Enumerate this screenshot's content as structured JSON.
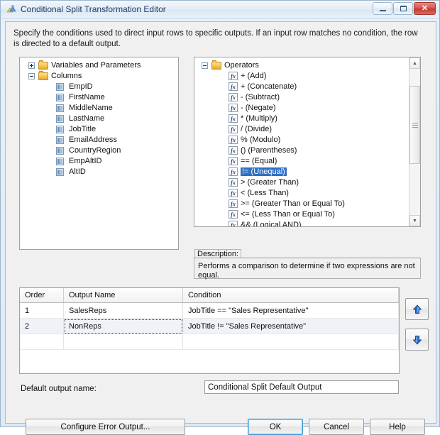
{
  "window": {
    "title": "Conditional Split Transformation Editor",
    "icon": "conditional-split-icon",
    "controls": {
      "minimize": "Minimize",
      "maximize": "Maximize",
      "close": "Close"
    }
  },
  "instructions": "Specify the conditions used to direct input rows to specific outputs. If an input row matches no condition, the row is directed to a default output.",
  "left_tree": {
    "nodes": [
      {
        "label": "Variables and Parameters",
        "icon": "folder-icon",
        "expander": "plus",
        "indent": 0
      },
      {
        "label": "Columns",
        "icon": "folder-icon",
        "expander": "minus",
        "indent": 0
      },
      {
        "label": "EmpID",
        "icon": "column-icon",
        "expander": "none",
        "indent": 1
      },
      {
        "label": "FirstName",
        "icon": "column-icon",
        "expander": "none",
        "indent": 1
      },
      {
        "label": "MiddleName",
        "icon": "column-icon",
        "expander": "none",
        "indent": 1
      },
      {
        "label": "LastName",
        "icon": "column-icon",
        "expander": "none",
        "indent": 1
      },
      {
        "label": "JobTitle",
        "icon": "column-icon",
        "expander": "none",
        "indent": 1
      },
      {
        "label": "EmailAddress",
        "icon": "column-icon",
        "expander": "none",
        "indent": 1
      },
      {
        "label": "CountryRegion",
        "icon": "column-icon",
        "expander": "none",
        "indent": 1
      },
      {
        "label": "EmpAltID",
        "icon": "column-icon",
        "expander": "none",
        "indent": 1
      },
      {
        "label": "AltID",
        "icon": "column-icon",
        "expander": "none",
        "indent": 1
      }
    ]
  },
  "right_tree": {
    "nodes": [
      {
        "label": "Operators",
        "icon": "folder-icon",
        "expander": "minus",
        "indent": 0,
        "selected": false
      },
      {
        "label": "+ (Add)",
        "icon": "fx-icon",
        "expander": "none",
        "indent": 1,
        "selected": false
      },
      {
        "label": "+ (Concatenate)",
        "icon": "fx-icon",
        "expander": "none",
        "indent": 1,
        "selected": false
      },
      {
        "label": "- (Subtract)",
        "icon": "fx-icon",
        "expander": "none",
        "indent": 1,
        "selected": false
      },
      {
        "label": "- (Negate)",
        "icon": "fx-icon",
        "expander": "none",
        "indent": 1,
        "selected": false
      },
      {
        "label": "* (Multiply)",
        "icon": "fx-icon",
        "expander": "none",
        "indent": 1,
        "selected": false
      },
      {
        "label": "/ (Divide)",
        "icon": "fx-icon",
        "expander": "none",
        "indent": 1,
        "selected": false
      },
      {
        "label": "% (Modulo)",
        "icon": "fx-icon",
        "expander": "none",
        "indent": 1,
        "selected": false
      },
      {
        "label": "() (Parentheses)",
        "icon": "fx-icon",
        "expander": "none",
        "indent": 1,
        "selected": false
      },
      {
        "label": "== (Equal)",
        "icon": "fx-icon",
        "expander": "none",
        "indent": 1,
        "selected": false
      },
      {
        "label": "!= (Unequal)",
        "icon": "fx-icon",
        "expander": "none",
        "indent": 1,
        "selected": true
      },
      {
        "label": "> (Greater Than)",
        "icon": "fx-icon",
        "expander": "none",
        "indent": 1,
        "selected": false
      },
      {
        "label": "< (Less Than)",
        "icon": "fx-icon",
        "expander": "none",
        "indent": 1,
        "selected": false
      },
      {
        "label": ">= (Greater Than or Equal To)",
        "icon": "fx-icon",
        "expander": "none",
        "indent": 1,
        "selected": false
      },
      {
        "label": "<= (Less Than or Equal To)",
        "icon": "fx-icon",
        "expander": "none",
        "indent": 1,
        "selected": false
      },
      {
        "label": "&& (Logical AND)",
        "icon": "fx-icon",
        "expander": "none",
        "indent": 1,
        "selected": false
      }
    ],
    "fx_glyph": "fx"
  },
  "description": {
    "label": "Description:",
    "text": "Performs a comparison to determine if two expressions are not equal."
  },
  "grid": {
    "columns": [
      "Order",
      "Output Name",
      "Condition"
    ],
    "rows": [
      {
        "order": "1",
        "output_name": "SalesReps",
        "condition": "JobTitle  ==  \"Sales Representative\""
      },
      {
        "order": "2",
        "output_name": "NonReps",
        "condition": "JobTitle  !=  \"Sales Representative\""
      },
      {
        "order": "",
        "output_name": "",
        "condition": ""
      }
    ]
  },
  "reorder": {
    "up": "move-up",
    "down": "move-down"
  },
  "default_output": {
    "label": "Default output name:",
    "value": "Conditional Split Default Output",
    "placeholder": ""
  },
  "buttons": {
    "configure_error_output": "Configure Error Output...",
    "ok": "OK",
    "cancel": "Cancel",
    "help": "Help"
  },
  "colors": {
    "selection_blue": "#2f6fc4",
    "focus_blue": "#3c97d4",
    "close_red": "#c0392f",
    "alt_row": "#eff3f8"
  }
}
